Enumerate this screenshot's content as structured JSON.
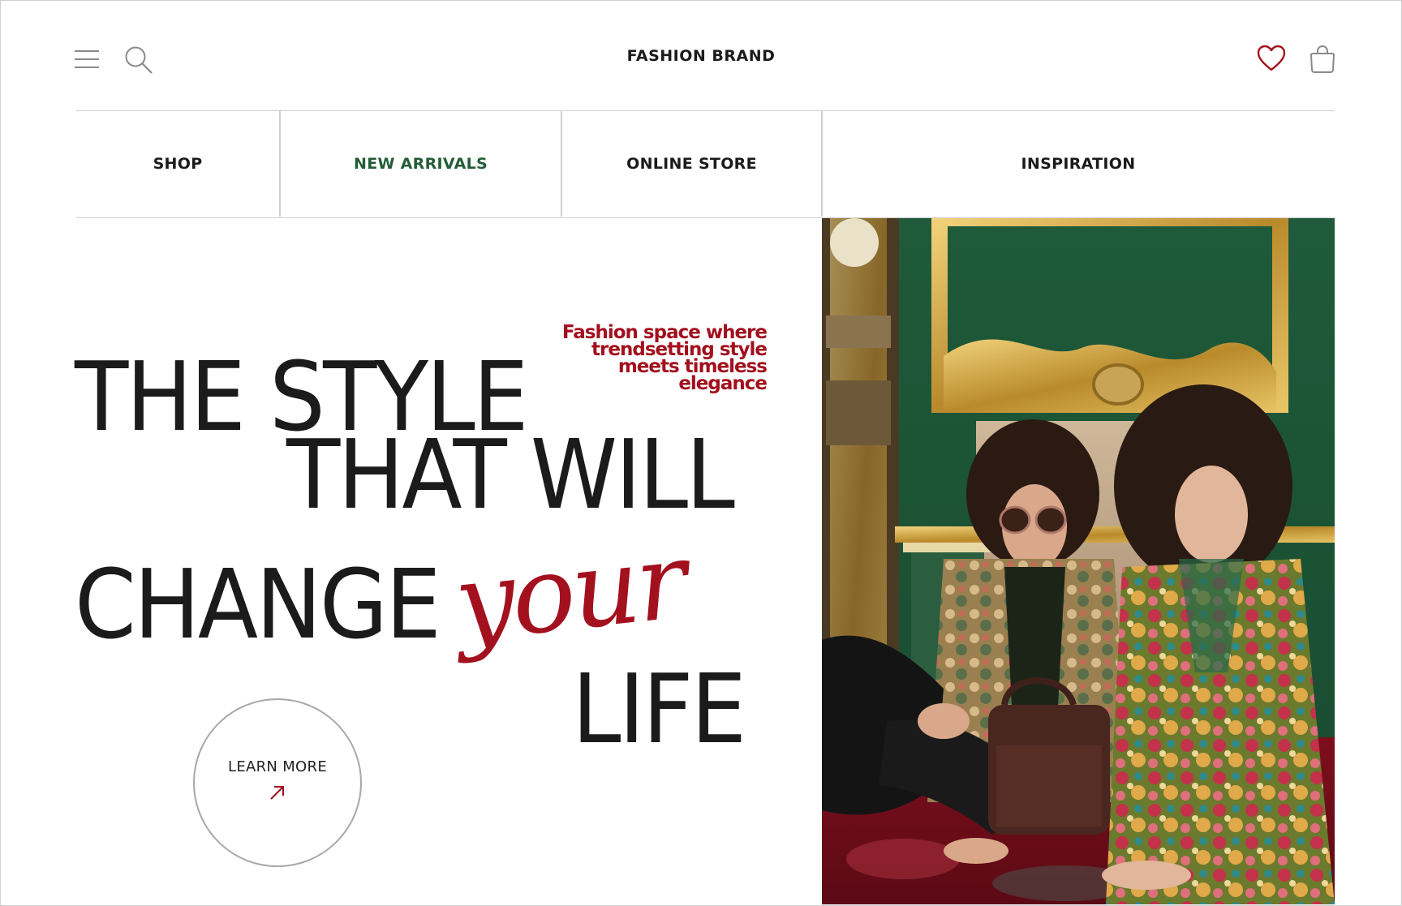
{
  "header": {
    "brand": "FASHION BRAND",
    "icons": [
      "menu-icon",
      "search-icon",
      "heart-icon",
      "shopping-bag-icon"
    ]
  },
  "nav": {
    "items": [
      {
        "label": "SHOP"
      },
      {
        "label": "NEW ARRIVALS",
        "active": true
      },
      {
        "label": "ONLINE STORE"
      },
      {
        "label": "INSPIRATION"
      }
    ]
  },
  "hero": {
    "line1": "THE STYLE",
    "line2": "THAT WILL",
    "line3": "CHANGE",
    "script_word": "your",
    "line4": "LIFE",
    "tagline": [
      "Fashion space where",
      "trendsetting style",
      "meets timeless",
      "elegance"
    ],
    "cta_label": "LEARN MORE"
  },
  "colors": {
    "accent_red": "#a3101e",
    "accent_green": "#235d36",
    "text": "#1b1b1b",
    "divider": "#cfcfcf"
  }
}
